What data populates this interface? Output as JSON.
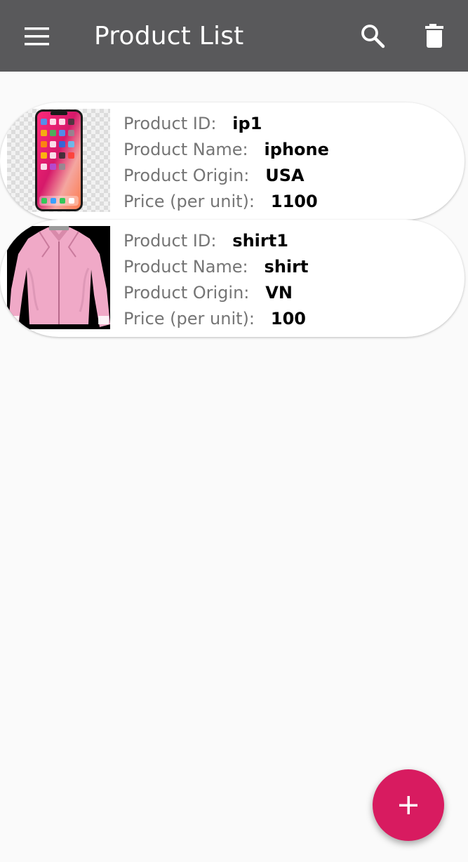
{
  "app_bar": {
    "title": "Product List",
    "menu_icon": "hamburger-menu-icon",
    "search_icon": "search-icon",
    "delete_icon": "trash-icon",
    "background_color": "#59595b"
  },
  "labels": {
    "id": "Product ID:",
    "name": "Product Name:",
    "origin": "Product Origin:",
    "price": "Price (per unit):"
  },
  "products": [
    {
      "id": "ip1",
      "name": "iphone",
      "origin": "USA",
      "price": "1100",
      "image": "smartphone-image"
    },
    {
      "id": "shirt1",
      "name": "shirt",
      "origin": "VN",
      "price": "100",
      "image": "pink-shirt-image"
    }
  ],
  "fab": {
    "icon": "plus-icon",
    "color": "#d81b60"
  }
}
